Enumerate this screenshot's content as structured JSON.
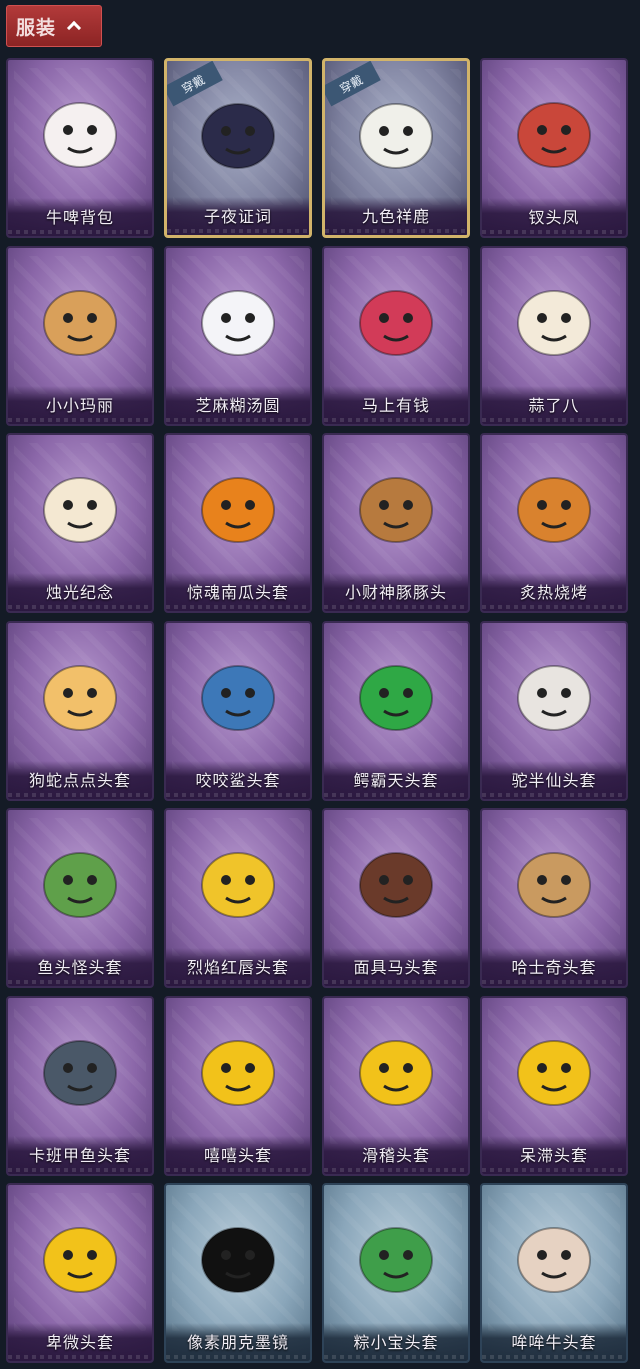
{
  "header": {
    "tab_label": "服装"
  },
  "badge_text": "穿戴",
  "items": [
    {
      "label": "牛啤背包",
      "icon": "cow-beer-backpack-icon",
      "color": "#f5f0f0",
      "frame": "purple"
    },
    {
      "label": "子夜证词",
      "icon": "owl-mask-icon",
      "color": "#2b2b4a",
      "frame": "equipped"
    },
    {
      "label": "九色祥鹿",
      "icon": "deer-pendant-icon",
      "color": "#f0f0ea",
      "frame": "equipped"
    },
    {
      "label": "钗头凤",
      "icon": "phoenix-crown-doll-icon",
      "color": "#c9473a",
      "frame": "purple"
    },
    {
      "label": "小小玛丽",
      "icon": "mary-doll-icon",
      "color": "#d9a05a",
      "frame": "purple"
    },
    {
      "label": "芝麻糊汤圆",
      "icon": "dumpling-icon",
      "color": "#f4f4f8",
      "frame": "purple"
    },
    {
      "label": "马上有钱",
      "icon": "red-horse-icon",
      "color": "#d23b58",
      "frame": "purple"
    },
    {
      "label": "蒜了八",
      "icon": "garlic-icon",
      "color": "#f3ead9",
      "frame": "purple"
    },
    {
      "label": "烛光纪念",
      "icon": "candle-icon",
      "color": "#f4e8d2",
      "frame": "purple"
    },
    {
      "label": "惊魂南瓜头套",
      "icon": "pumpkin-icon",
      "color": "#e8821c",
      "frame": "purple"
    },
    {
      "label": "小财神豚豚头",
      "icon": "capybara-icon",
      "color": "#b77a3e",
      "frame": "purple"
    },
    {
      "label": "炙热烧烤",
      "icon": "bbq-meat-icon",
      "color": "#d9822e",
      "frame": "purple"
    },
    {
      "label": "狗蛇点点头套",
      "icon": "snake-dog-icon",
      "color": "#f2c06a",
      "frame": "purple"
    },
    {
      "label": "咬咬鲨头套",
      "icon": "shark-icon",
      "color": "#3d78b8",
      "frame": "purple"
    },
    {
      "label": "鳄霸天头套",
      "icon": "crocodile-icon",
      "color": "#2fa845",
      "frame": "purple"
    },
    {
      "label": "驼半仙头套",
      "icon": "alpaca-sunglasses-icon",
      "color": "#e8e4e0",
      "frame": "purple"
    },
    {
      "label": "鱼头怪头套",
      "icon": "fish-head-icon",
      "color": "#5fa04a",
      "frame": "purple"
    },
    {
      "label": "烈焰红唇头套",
      "icon": "yellow-mouse-icon",
      "color": "#f0c42a",
      "frame": "purple"
    },
    {
      "label": "面具马头套",
      "icon": "horse-mask-icon",
      "color": "#6a3a2a",
      "frame": "purple"
    },
    {
      "label": "哈士奇头套",
      "icon": "husky-icon",
      "color": "#c99a60",
      "frame": "purple"
    },
    {
      "label": "卡班甲鱼头套",
      "icon": "puffer-fish-icon",
      "color": "#4a5868",
      "frame": "purple"
    },
    {
      "label": "嘻嘻头套",
      "icon": "grin-emoji-icon",
      "color": "#f2c21a",
      "frame": "purple"
    },
    {
      "label": "滑稽头套",
      "icon": "funny-emoji-icon",
      "color": "#f2c21a",
      "frame": "purple"
    },
    {
      "label": "呆滞头套",
      "icon": "blank-stare-emoji-icon",
      "color": "#f2c21a",
      "frame": "purple"
    },
    {
      "label": "卑微头套",
      "icon": "humble-emoji-icon",
      "color": "#f2c21a",
      "frame": "purple"
    },
    {
      "label": "像素朋克墨镜",
      "icon": "pixel-sunglasses-icon",
      "color": "#111111",
      "frame": "blue"
    },
    {
      "label": "粽小宝头套",
      "icon": "zongzi-icon",
      "color": "#3f9e4a",
      "frame": "blue"
    },
    {
      "label": "哞哞牛头套",
      "icon": "cow-head-icon",
      "color": "#e6d2c2",
      "frame": "blue"
    }
  ]
}
